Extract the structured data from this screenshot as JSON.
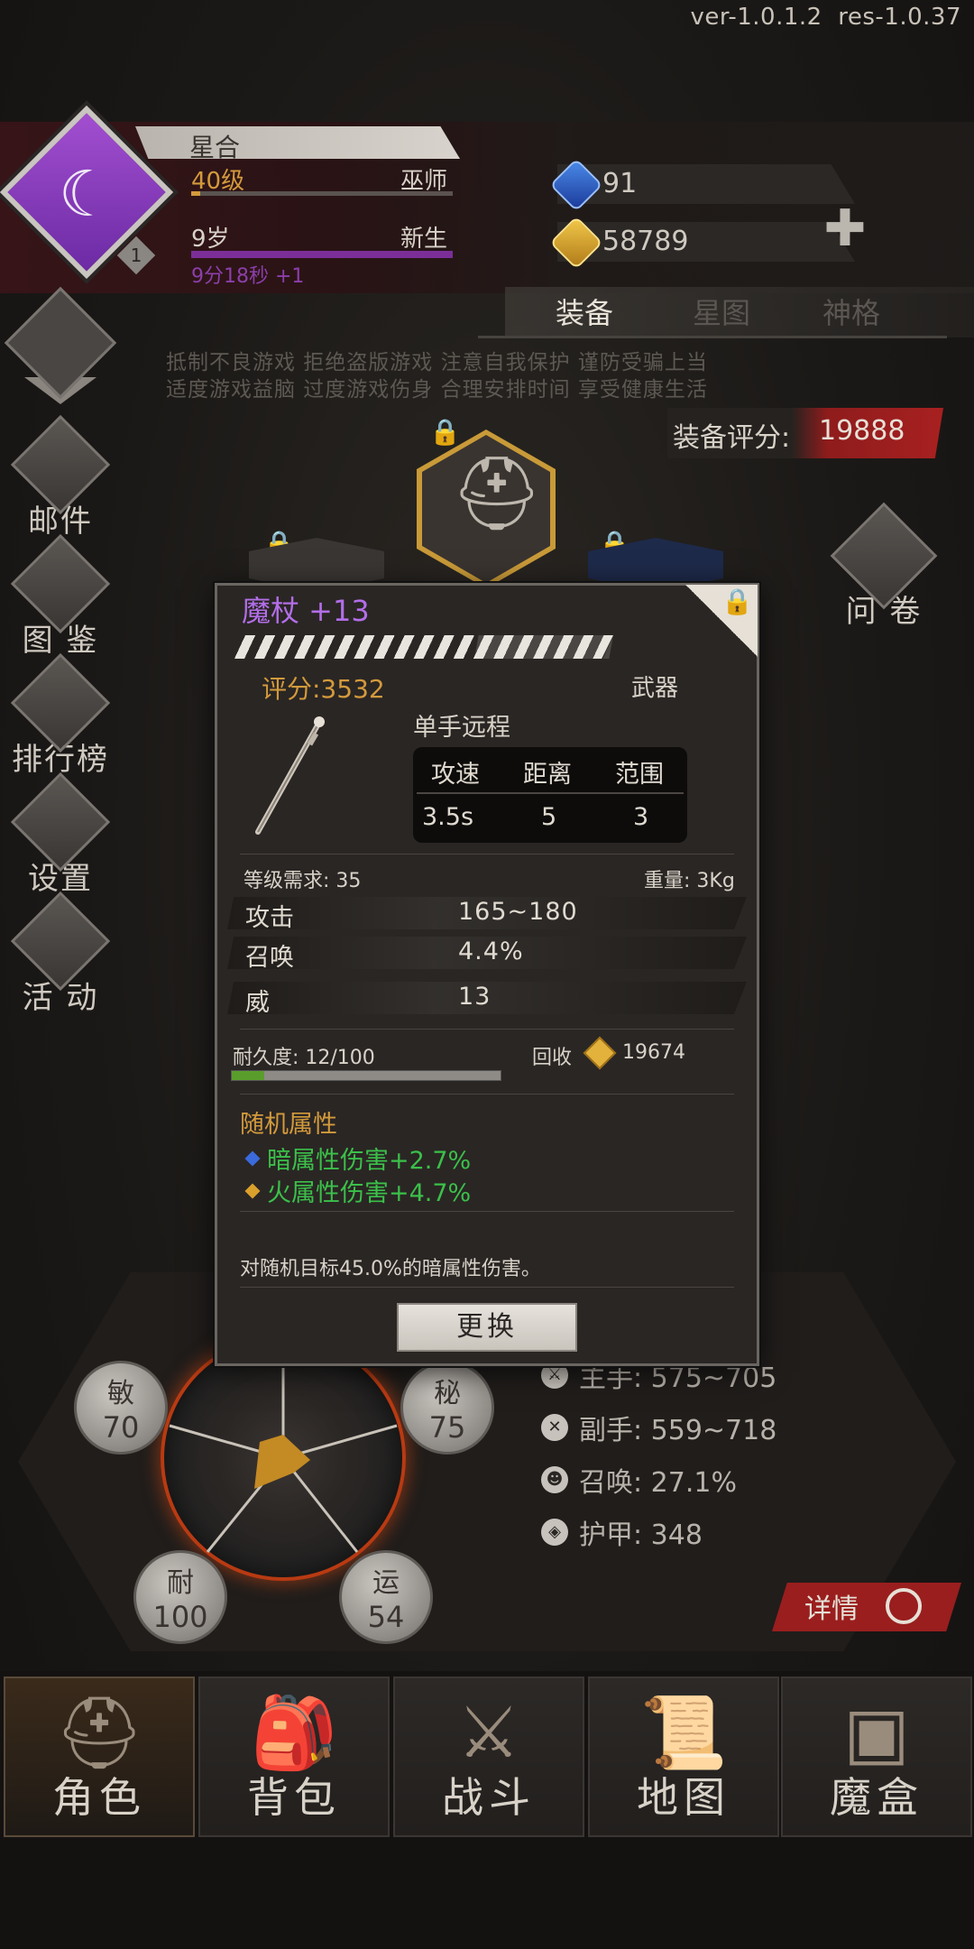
{
  "version": {
    "ver": "ver-1.0.1.2",
    "res": "res-1.0.37"
  },
  "player": {
    "name": "星合",
    "level": "40级",
    "class": "巫师",
    "age": "9岁",
    "stage": "新生",
    "timer": "9分18秒 +1",
    "badge": "1"
  },
  "currency": {
    "gems": "91",
    "gold": "58789"
  },
  "tabs": [
    {
      "label": "装备",
      "active": true
    },
    {
      "label": "星图",
      "active": false
    },
    {
      "label": "神格",
      "active": false
    }
  ],
  "notice": {
    "line1": "抵制不良游戏 拒绝盗版游戏 注意自我保护 谨防受骗上当",
    "line2": "适度游戏益脑 过度游戏伤身 合理安排时间 享受健康生活"
  },
  "equip_score": {
    "label": "装备评分:",
    "value": "19888"
  },
  "side_menu": [
    {
      "label": "邮件",
      "icon": "mail-icon"
    },
    {
      "label": "图 鉴",
      "icon": "book-icon"
    },
    {
      "label": "排行榜",
      "icon": "ranking-icon"
    },
    {
      "label": "设置",
      "icon": "gear-icon"
    },
    {
      "label": "活 动",
      "icon": "event-icon"
    }
  ],
  "help": {
    "label": "问 卷",
    "icon": "question-icon"
  },
  "attributes": [
    {
      "name": "敏",
      "value": "70"
    },
    {
      "name": "秘",
      "value": "75"
    },
    {
      "name": "耐",
      "value": "100"
    },
    {
      "name": "运",
      "value": "54"
    }
  ],
  "stats": [
    {
      "text": "主手: 575~705",
      "icon": "sword-icon"
    },
    {
      "text": "副手: 559~718",
      "icon": "offhand-icon"
    },
    {
      "text": "召唤: 27.1%",
      "icon": "summon-icon"
    },
    {
      "text": "护甲: 348",
      "icon": "armor-icon"
    }
  ],
  "detail_button": "详情",
  "nav": [
    {
      "label": "角色",
      "icon": "helmet-icon",
      "active": true
    },
    {
      "label": "背包",
      "icon": "backpack-icon",
      "active": false
    },
    {
      "label": "战斗",
      "icon": "shield-sword-icon",
      "active": false
    },
    {
      "label": "地图",
      "icon": "scroll-map-icon",
      "active": false
    },
    {
      "label": "魔盒",
      "icon": "magic-box-icon",
      "active": false
    }
  ],
  "item": {
    "name": "魔杖 +13",
    "rating": "评分:3532",
    "type": "武器",
    "hand": "单手远程",
    "spec_headers": [
      "攻速",
      "距离",
      "范围"
    ],
    "spec_values": [
      "3.5s",
      "5",
      "3"
    ],
    "level_req": "等级需求: 35",
    "weight": "重量: 3Kg",
    "attrs": [
      {
        "k": "攻击",
        "v": "165~180"
      },
      {
        "k": "召唤",
        "v": "4.4%"
      },
      {
        "k": "威",
        "v": "13"
      }
    ],
    "durability": "耐久度: 12/100",
    "durability_fraction": 0.12,
    "recycle_label": "回收",
    "recycle_value": "19674",
    "random_title": "随机属性",
    "random_attrs": [
      {
        "text": "暗属性伤害+2.7%",
        "gem_color": "#3a6adc"
      },
      {
        "text": "火属性伤害+4.7%",
        "gem_color": "#d9a02c"
      }
    ],
    "description": "对随机目标45.0%的暗属性伤害。",
    "swap_button": "更换"
  },
  "colors": {
    "accent_gold": "#d39a3c",
    "purple_name": "#b26ee8",
    "green_attr": "#3bc04a",
    "score_red": "#a82020"
  }
}
